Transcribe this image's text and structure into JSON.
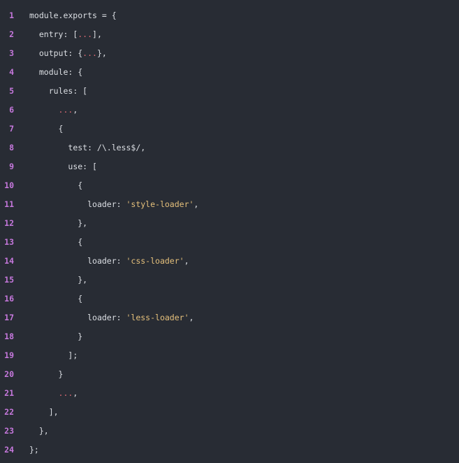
{
  "colors": {
    "background": "#282c34",
    "line_number": "#c678dd",
    "plain": "#dcdfe4",
    "ellipsis": "#e06c75",
    "string": "#e5c07b"
  },
  "code": {
    "lines": [
      {
        "n": "1",
        "indent": "",
        "tokens": [
          {
            "t": "plain",
            "v": "module.exports = {"
          }
        ]
      },
      {
        "n": "2",
        "indent": "  ",
        "tokens": [
          {
            "t": "plain",
            "v": "entry: ["
          },
          {
            "t": "ellipsis",
            "v": "..."
          },
          {
            "t": "plain",
            "v": "],"
          }
        ]
      },
      {
        "n": "3",
        "indent": "  ",
        "tokens": [
          {
            "t": "plain",
            "v": "output: {"
          },
          {
            "t": "ellipsis",
            "v": "..."
          },
          {
            "t": "plain",
            "v": "},"
          }
        ]
      },
      {
        "n": "4",
        "indent": "  ",
        "tokens": [
          {
            "t": "plain",
            "v": "module: {"
          }
        ]
      },
      {
        "n": "5",
        "indent": "    ",
        "tokens": [
          {
            "t": "plain",
            "v": "rules: ["
          }
        ]
      },
      {
        "n": "6",
        "indent": "      ",
        "tokens": [
          {
            "t": "ellipsis",
            "v": "..."
          },
          {
            "t": "plain",
            "v": ","
          }
        ]
      },
      {
        "n": "7",
        "indent": "      ",
        "tokens": [
          {
            "t": "plain",
            "v": "{"
          }
        ]
      },
      {
        "n": "8",
        "indent": "        ",
        "tokens": [
          {
            "t": "plain",
            "v": "test: /\\.less$/,"
          }
        ]
      },
      {
        "n": "9",
        "indent": "        ",
        "tokens": [
          {
            "t": "plain",
            "v": "use: ["
          }
        ]
      },
      {
        "n": "10",
        "indent": "          ",
        "tokens": [
          {
            "t": "plain",
            "v": "{"
          }
        ]
      },
      {
        "n": "11",
        "indent": "            ",
        "tokens": [
          {
            "t": "plain",
            "v": "loader: "
          },
          {
            "t": "string",
            "v": "'style-loader'"
          },
          {
            "t": "plain",
            "v": ","
          }
        ]
      },
      {
        "n": "12",
        "indent": "          ",
        "tokens": [
          {
            "t": "plain",
            "v": "},"
          }
        ]
      },
      {
        "n": "13",
        "indent": "          ",
        "tokens": [
          {
            "t": "plain",
            "v": "{"
          }
        ]
      },
      {
        "n": "14",
        "indent": "            ",
        "tokens": [
          {
            "t": "plain",
            "v": "loader: "
          },
          {
            "t": "string",
            "v": "'css-loader'"
          },
          {
            "t": "plain",
            "v": ","
          }
        ]
      },
      {
        "n": "15",
        "indent": "          ",
        "tokens": [
          {
            "t": "plain",
            "v": "},"
          }
        ]
      },
      {
        "n": "16",
        "indent": "          ",
        "tokens": [
          {
            "t": "plain",
            "v": "{"
          }
        ]
      },
      {
        "n": "17",
        "indent": "            ",
        "tokens": [
          {
            "t": "plain",
            "v": "loader: "
          },
          {
            "t": "string",
            "v": "'less-loader'"
          },
          {
            "t": "plain",
            "v": ","
          }
        ]
      },
      {
        "n": "18",
        "indent": "          ",
        "tokens": [
          {
            "t": "plain",
            "v": "}"
          }
        ]
      },
      {
        "n": "19",
        "indent": "        ",
        "tokens": [
          {
            "t": "plain",
            "v": "];"
          }
        ]
      },
      {
        "n": "20",
        "indent": "      ",
        "tokens": [
          {
            "t": "plain",
            "v": "}"
          }
        ]
      },
      {
        "n": "21",
        "indent": "      ",
        "tokens": [
          {
            "t": "ellipsis",
            "v": "..."
          },
          {
            "t": "plain",
            "v": ","
          }
        ]
      },
      {
        "n": "22",
        "indent": "    ",
        "tokens": [
          {
            "t": "plain",
            "v": "],"
          }
        ]
      },
      {
        "n": "23",
        "indent": "  ",
        "tokens": [
          {
            "t": "plain",
            "v": "},"
          }
        ]
      },
      {
        "n": "24",
        "indent": "",
        "tokens": [
          {
            "t": "plain",
            "v": "};"
          }
        ]
      }
    ]
  }
}
